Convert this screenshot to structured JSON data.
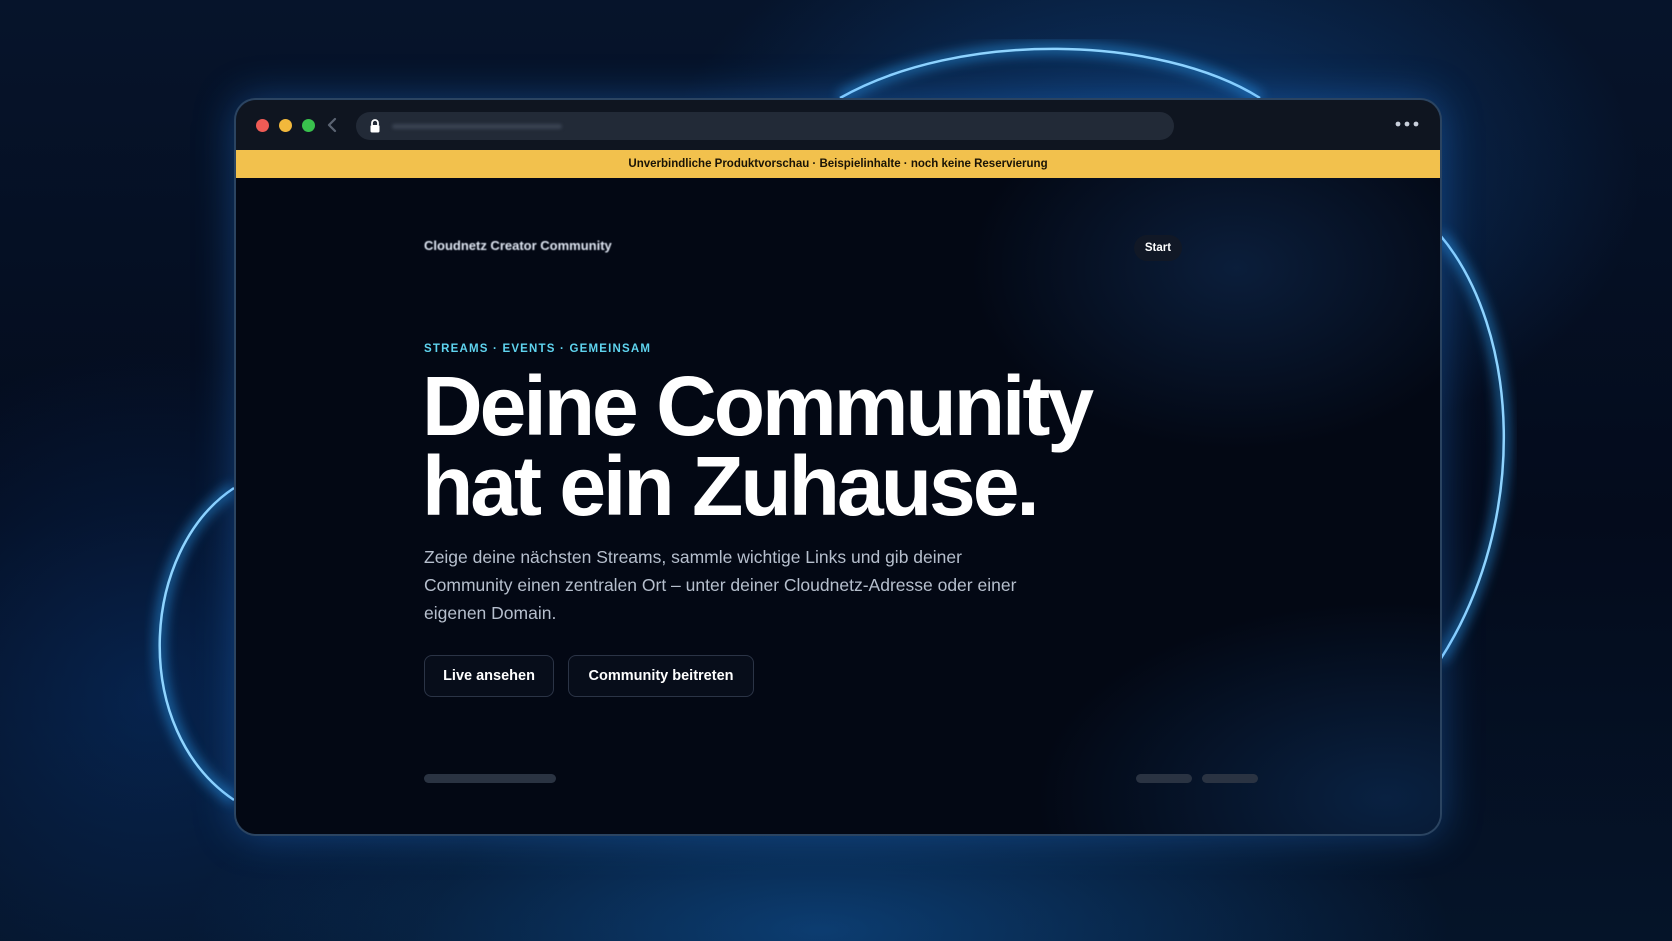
{
  "browser": {
    "icons": {
      "back": "chevron-left-icon",
      "lock": "lock-icon",
      "menu": "more-horizontal-icon"
    },
    "colors": {
      "close": "#ee5b55",
      "minimize": "#f2b83c",
      "maximize": "#39c14d"
    }
  },
  "banner": {
    "text": "Unverbindliche Produktvorschau · Beispielinhalte · noch keine Reservierung",
    "color": "#f2c14d"
  },
  "nav": {
    "brand": "Cloudnetz Creator Community",
    "start_label": "Start"
  },
  "hero": {
    "eyebrow": "STREAMS · EVENTS · GEMEINSAM",
    "headline_line1": "Deine Community",
    "headline_line2": "hat ein Zuhause.",
    "lead": "Zeige deine nächsten Streams, sammle wichtige Links und gib deiner Community einen zentralen Ort – unter deiner Cloudnetz-Adresse oder einer eigenen Domain.",
    "primary_button": "Live ansehen",
    "secondary_button": "Community beitreten",
    "accent_color": "#5fd4ef"
  }
}
